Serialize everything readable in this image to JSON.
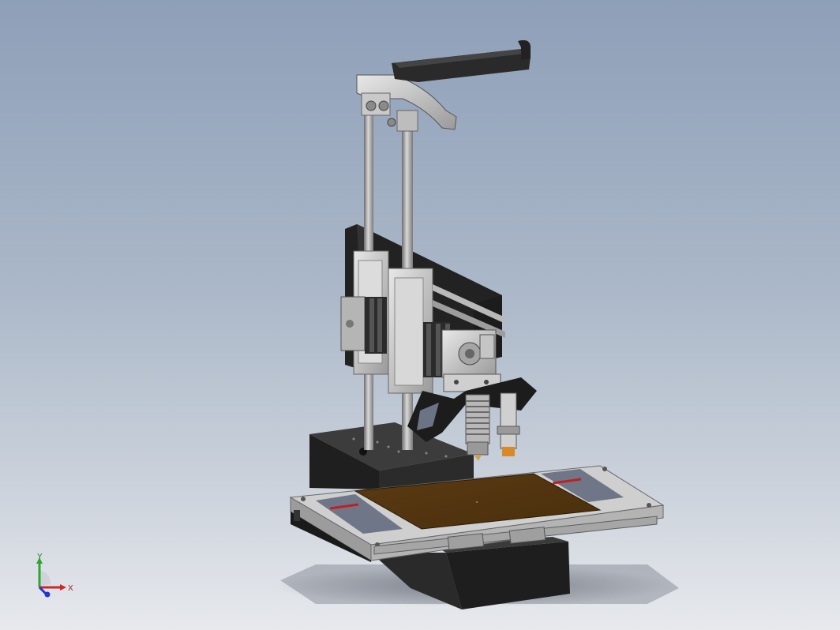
{
  "viewport": {
    "background_top": "#8e9fb8",
    "background_bottom": "#e7e9ed"
  },
  "triad": {
    "x_label": "X",
    "y_label": "Y",
    "x_color": "#d0262a",
    "y_color": "#2aa82a",
    "z_color": "#2436c8"
  }
}
